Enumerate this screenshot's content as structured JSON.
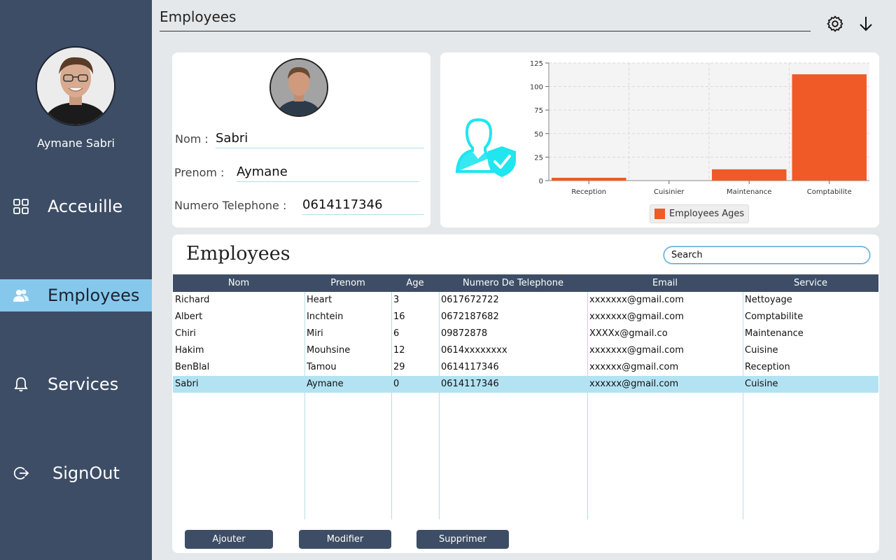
{
  "sidebar": {
    "user_name": "Aymane Sabri",
    "items": [
      {
        "label": "Acceuille",
        "icon": "grid-icon"
      },
      {
        "label": "Employees",
        "icon": "users-icon"
      },
      {
        "label": "Services",
        "icon": "bell-icon"
      },
      {
        "label": "SignOut",
        "icon": "signout-icon"
      }
    ],
    "active": "Employees",
    "colors": {
      "background": "#3d4d66",
      "active": "#86c8ec"
    }
  },
  "header": {
    "title": "Employees",
    "icons": [
      "gear-icon",
      "arrow-down-icon"
    ]
  },
  "profile": {
    "nom_label": "Nom :",
    "nom_value": "Sabri",
    "prenom_label": "Prenom :",
    "prenom_value": "Aymane",
    "tel_label": "Numero Telephone :",
    "tel_value": "0614117346"
  },
  "chart_data": {
    "type": "bar",
    "categories": [
      "Reception",
      "Cuisinier",
      "Maintenance",
      "Comptabilite"
    ],
    "series": [
      {
        "name": "Employees Ages",
        "values": [
          3,
          0,
          12,
          113
        ]
      }
    ],
    "ylim": [
      0,
      125
    ],
    "yticks": [
      0,
      25,
      50,
      75,
      100,
      125
    ],
    "grid": true,
    "legend": "bottom",
    "bar_color": "#f05a26",
    "plot_background": "#f4f4f4"
  },
  "table": {
    "title": "Employees",
    "search_placeholder": "Search",
    "columns": [
      "Nom",
      "Prenom",
      "Age",
      "Numero De Telephone",
      "Email",
      "Service"
    ],
    "rows": [
      [
        "Richard",
        "Heart",
        "3",
        "0617672722",
        "xxxxxxx@gmail.com",
        "Nettoyage"
      ],
      [
        "Albert",
        "Inchtein",
        "16",
        "0672187682",
        "xxxxxxx@gmail.com",
        "Comptabilite"
      ],
      [
        "Chiri",
        "Miri",
        "6",
        "09872878",
        "XXXXx@gmail.co",
        "Maintenance"
      ],
      [
        "Hakim",
        "Mouhsine",
        "12",
        "0614xxxxxxxx",
        "xxxxxxx@gmail.com",
        "Cuisine"
      ],
      [
        "BenBlal",
        "Tamou",
        "29",
        "0614117346",
        "xxxxxx@gmail.com",
        "Reception"
      ],
      [
        "Sabri",
        "Aymane",
        "0",
        "0614117346",
        "xxxxxx@gmail.com",
        "Cuisine"
      ]
    ],
    "selected_row": 5
  },
  "buttons": {
    "add": "Ajouter",
    "edit": "Modifier",
    "delete": "Supprimer"
  }
}
